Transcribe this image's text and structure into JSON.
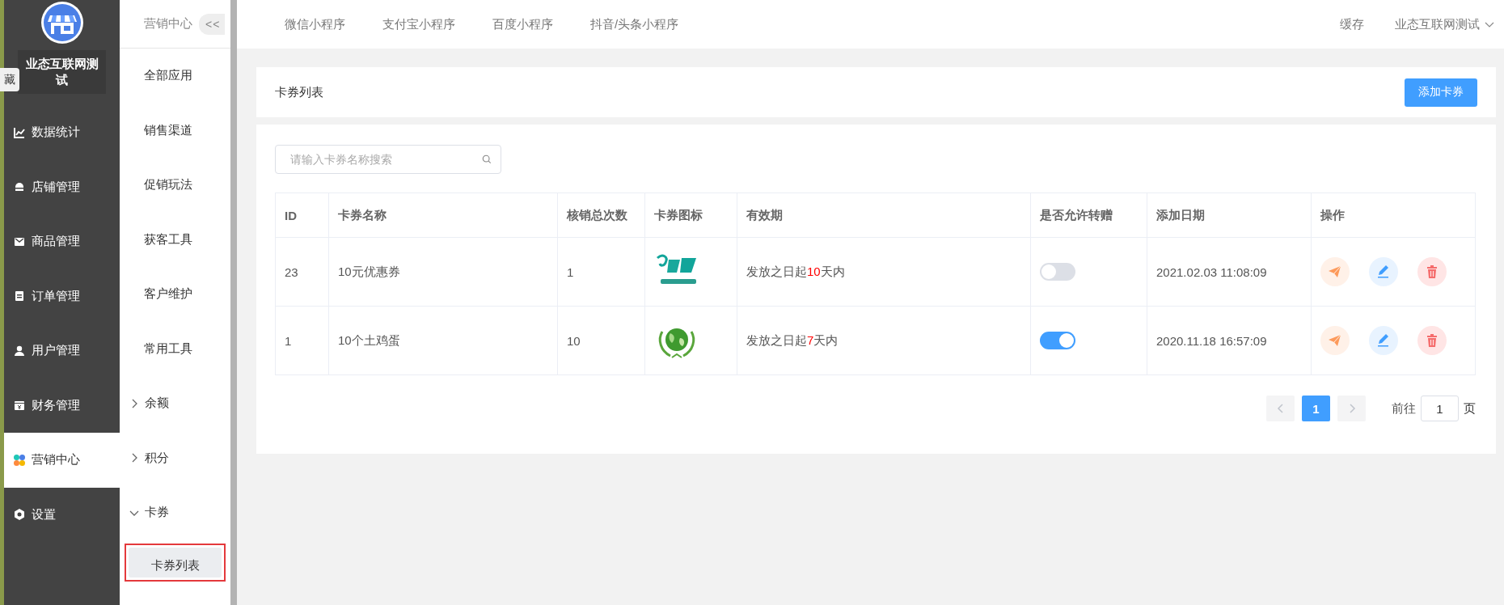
{
  "side_nav": {
    "hide_tab": "藏",
    "shop_name": "业态互联网测试",
    "items": [
      {
        "label": "数据统计",
        "selected": false
      },
      {
        "label": "店铺管理",
        "selected": false
      },
      {
        "label": "商品管理",
        "selected": false
      },
      {
        "label": "订单管理",
        "selected": false
      },
      {
        "label": "用户管理",
        "selected": false
      },
      {
        "label": "财务管理",
        "selected": false
      },
      {
        "label": "营销中心",
        "selected": true
      },
      {
        "label": "设置",
        "selected": false
      }
    ]
  },
  "sub_nav": {
    "title": "营销中心",
    "collapse": "<<",
    "items": [
      {
        "kind": "link",
        "label": "全部应用"
      },
      {
        "kind": "link",
        "label": "销售渠道"
      },
      {
        "kind": "link",
        "label": "促销玩法"
      },
      {
        "kind": "link",
        "label": "获客工具"
      },
      {
        "kind": "link",
        "label": "客户维护"
      },
      {
        "kind": "link",
        "label": "常用工具"
      },
      {
        "kind": "group",
        "label": "余额",
        "expanded": false
      },
      {
        "kind": "group",
        "label": "积分",
        "expanded": false
      },
      {
        "kind": "group",
        "label": "卡券",
        "expanded": true,
        "children": [
          {
            "label": "卡券列表",
            "selected": true,
            "highlighted": true
          }
        ]
      }
    ]
  },
  "top_tabs": [
    {
      "label": "微信小程序",
      "selected": false
    },
    {
      "label": "支付宝小程序",
      "selected": false
    },
    {
      "label": "百度小程序",
      "selected": false
    },
    {
      "label": "抖音/头条小程序",
      "selected": false
    }
  ],
  "top_right": {
    "cache": "缓存",
    "user": "业态互联网测试"
  },
  "page": {
    "title": "卡券列表",
    "add_button": "添加卡券"
  },
  "search": {
    "placeholder": "请输入卡券名称搜索"
  },
  "table": {
    "columns": [
      "ID",
      "卡券名称",
      "核销总次数",
      "卡券图标",
      "有效期",
      "是否允许转赠",
      "添加日期",
      "操作"
    ],
    "rows": [
      {
        "id": "23",
        "name": "10元优惠券",
        "uses": "1",
        "validity": {
          "prefix": "发放之日起",
          "number": "10",
          "suffix": "天内"
        },
        "transferable": false,
        "date": "2021.02.03 11:08:09"
      },
      {
        "id": "1",
        "name": "10个土鸡蛋",
        "uses": "10",
        "validity": {
          "prefix": "发放之日起",
          "number": "7",
          "suffix": "天内"
        },
        "transferable": true,
        "date": "2020.11.18 16:57:09"
      }
    ]
  },
  "pagination": {
    "pages": [
      {
        "label": "1",
        "selected": true
      }
    ],
    "goto_label": "前往",
    "goto_value": "1",
    "page_suffix": "页"
  }
}
